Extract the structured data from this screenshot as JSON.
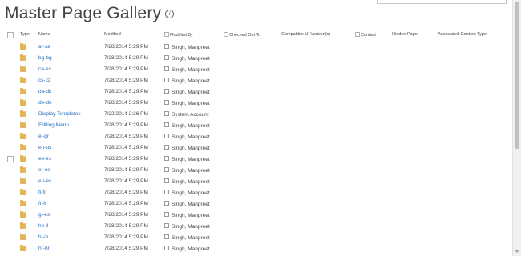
{
  "page": {
    "title": "Master Page Gallery",
    "info_icon": "info-icon"
  },
  "columns": [
    {
      "key": "type",
      "label": "Type"
    },
    {
      "key": "name",
      "label": "Name"
    },
    {
      "key": "modified",
      "label": "Modified"
    },
    {
      "key": "modified_by",
      "label": "Modified By"
    },
    {
      "key": "checked_out_to",
      "label": "Checked Out To"
    },
    {
      "key": "compatible_ui",
      "label": "Compatible UI Version(s)"
    },
    {
      "key": "contact",
      "label": "Contact"
    },
    {
      "key": "hidden_page",
      "label": "Hidden Page"
    },
    {
      "key": "assoc_content_type",
      "label": "Associated Content Type"
    }
  ],
  "rows": [
    {
      "name": "ar-sa",
      "modified": "7/28/2014 5:29 PM",
      "modified_by": "Singh, Manpreet"
    },
    {
      "name": "bg-bg",
      "modified": "7/28/2014 5:29 PM",
      "modified_by": "Singh, Manpreet"
    },
    {
      "name": "ca-es",
      "modified": "7/28/2014 5:29 PM",
      "modified_by": "Singh, Manpreet"
    },
    {
      "name": "cs-cz",
      "modified": "7/28/2014 5:29 PM",
      "modified_by": "Singh, Manpreet"
    },
    {
      "name": "da-dk",
      "modified": "7/28/2014 5:29 PM",
      "modified_by": "Singh, Manpreet"
    },
    {
      "name": "de-de",
      "modified": "7/28/2014 5:29 PM",
      "modified_by": "Singh, Manpreet"
    },
    {
      "name": "Display Templates",
      "modified": "7/22/2014 2:36 PM",
      "modified_by": "System Account"
    },
    {
      "name": "Editing Menu",
      "modified": "7/28/2014 5:29 PM",
      "modified_by": "Singh, Manpreet"
    },
    {
      "name": "el-gr",
      "modified": "7/28/2014 5:29 PM",
      "modified_by": "Singh, Manpreet"
    },
    {
      "name": "en-us",
      "modified": "7/28/2014 5:29 PM",
      "modified_by": "Singh, Manpreet"
    },
    {
      "name": "es-es",
      "modified": "7/28/2014 5:29 PM",
      "modified_by": "Singh, Manpreet",
      "show_check": true
    },
    {
      "name": "et-ee",
      "modified": "7/28/2014 5:29 PM",
      "modified_by": "Singh, Manpreet"
    },
    {
      "name": "eu-es",
      "modified": "7/28/2014 5:29 PM",
      "modified_by": "Singh, Manpreet"
    },
    {
      "name": "fi-fi",
      "modified": "7/28/2014 5:29 PM",
      "modified_by": "Singh, Manpreet"
    },
    {
      "name": "fr-fr",
      "modified": "7/28/2014 5:29 PM",
      "modified_by": "Singh, Manpreet"
    },
    {
      "name": "gl-es",
      "modified": "7/28/2014 5:29 PM",
      "modified_by": "Singh, Manpreet"
    },
    {
      "name": "he-il",
      "modified": "7/28/2014 5:29 PM",
      "modified_by": "Singh, Manpreet"
    },
    {
      "name": "hi-in",
      "modified": "7/28/2014 5:29 PM",
      "modified_by": "Singh, Manpreet"
    },
    {
      "name": "hr-hr",
      "modified": "7/28/2014 5:29 PM",
      "modified_by": "Singh, Manpreet"
    }
  ],
  "colors": {
    "link": "#2a6ebb",
    "folder": "#e2b558",
    "text": "#444444"
  }
}
